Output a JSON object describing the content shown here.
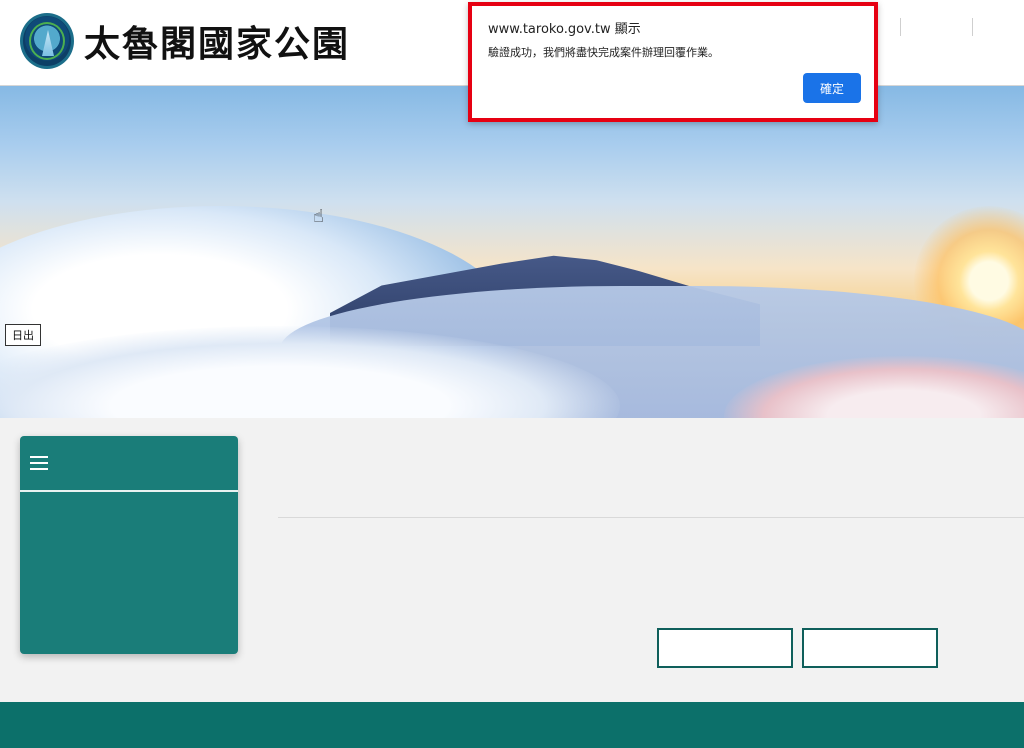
{
  "header": {
    "site_title": "太魯閣國家公園",
    "logo_name": "taroko-national-park-emblem"
  },
  "hero": {
    "time_badge": "日出"
  },
  "dialog": {
    "title": "www.taroko.gov.tw 顯示",
    "message": "驗證成功，我們將盡快完成案件辦理回覆作業。",
    "ok_label": "確定",
    "highlight_color": "#e60012"
  },
  "colors": {
    "primary_teal": "#1a7d79",
    "footer_teal": "#0c706a",
    "button_blue": "#1a73e8"
  },
  "icons": {
    "menu": "hamburger-icon",
    "cursor": "hand-pointer-icon"
  }
}
